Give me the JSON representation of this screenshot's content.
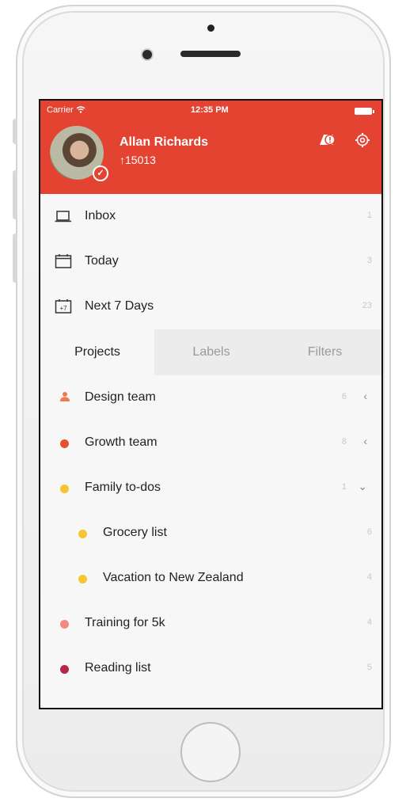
{
  "status_bar": {
    "carrier": "Carrier",
    "time": "12:35 PM"
  },
  "user": {
    "name": "Allan Richards",
    "karma": "↑15013"
  },
  "nav_items": [
    {
      "label": "Inbox",
      "count": "1",
      "icon": "inbox-icon"
    },
    {
      "label": "Today",
      "count": "3",
      "icon": "calendar-icon"
    },
    {
      "label": "Next 7 Days",
      "count": "23",
      "icon": "calendar-plus7-icon"
    }
  ],
  "next7_icon_text": "+7",
  "tabs": [
    {
      "label": "Projects",
      "active": true
    },
    {
      "label": "Labels",
      "active": false
    },
    {
      "label": "Filters",
      "active": false
    }
  ],
  "projects": [
    {
      "label": "Design team",
      "count": "6",
      "color": "#ef7b4c",
      "shared": true,
      "chevron": "‹"
    },
    {
      "label": "Growth team",
      "count": "8",
      "color": "#e4532f",
      "shared": false,
      "chevron": "‹"
    },
    {
      "label": "Family to-dos",
      "count": "1",
      "color": "#f7c531",
      "shared": false,
      "chevron": "⌄"
    },
    {
      "label": "Grocery list",
      "count": "6",
      "color": "#f7c531",
      "sub": true
    },
    {
      "label": "Vacation to New Zealand",
      "count": "4",
      "color": "#f7c531",
      "sub": true
    },
    {
      "label": "Training for 5k",
      "count": "4",
      "color": "#f08a7e"
    },
    {
      "label": "Reading list",
      "count": "5",
      "color": "#b8254a"
    }
  ],
  "colors": {
    "header": "#e44332"
  }
}
